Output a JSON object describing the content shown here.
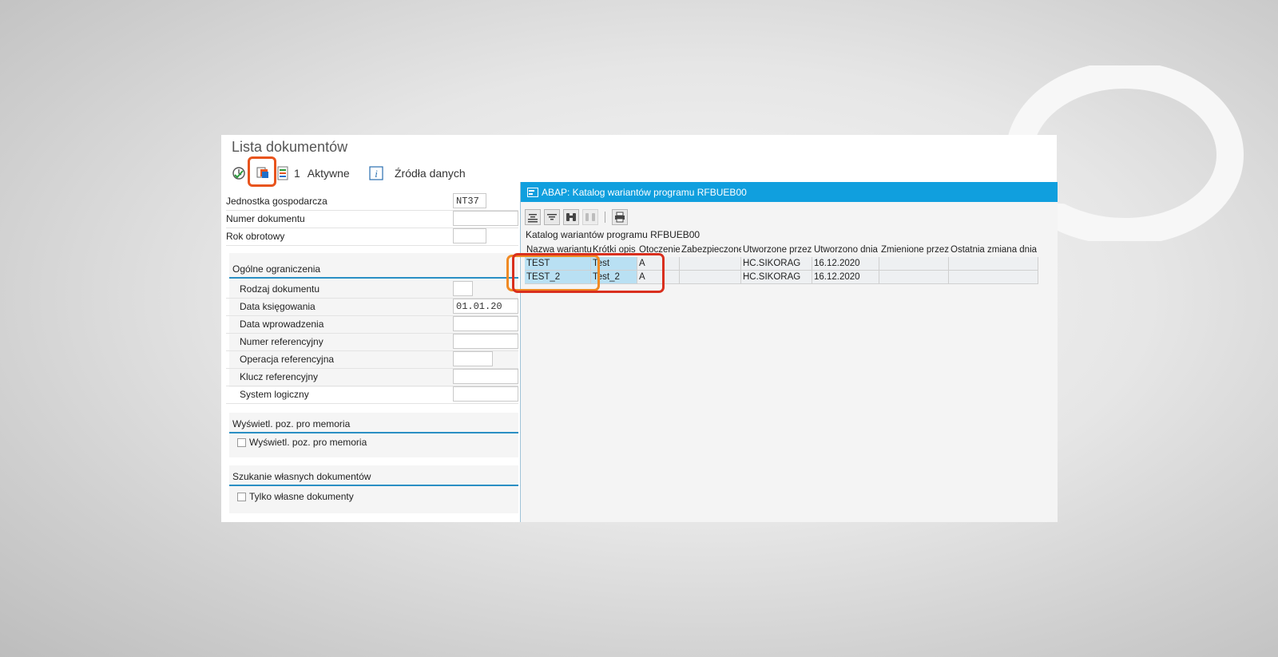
{
  "app": {
    "title": "Lista dokumentów"
  },
  "toolbar": {
    "count": "1",
    "active_label": "Aktywne",
    "sources_label": "Źródła danych"
  },
  "form": {
    "company_code": {
      "label": "Jednostka gospodarcza",
      "value": "NT37"
    },
    "doc_number": {
      "label": "Numer dokumentu",
      "value": ""
    },
    "fiscal_year": {
      "label": "Rok obrotowy",
      "value": ""
    },
    "general_group": {
      "title": "Ogólne ograniczenia",
      "doc_type": {
        "label": "Rodzaj dokumentu",
        "value": ""
      },
      "posting_date": {
        "label": "Data księgowania",
        "value": "01.01.20"
      },
      "entry_date": {
        "label": "Data wprowadzenia",
        "value": ""
      },
      "ref_number": {
        "label": "Numer referencyjny",
        "value": ""
      },
      "ref_operation": {
        "label": "Operacja referencyjna",
        "value": ""
      },
      "ref_key": {
        "label": "Klucz referencyjny",
        "value": ""
      },
      "logical_system": {
        "label": "System logiczny",
        "value": ""
      }
    },
    "memo_group": {
      "title": "Wyświetl. poz. pro memoria",
      "checkbox_label": "Wyświetl. poz. pro memoria"
    },
    "own_group": {
      "title": "Szukanie własnych dokumentów",
      "checkbox_label": "Tylko własne dokumenty"
    }
  },
  "popup": {
    "title": "ABAP: Katalog wariantów programu RFBUEB00",
    "subtitle": "Katalog wariantów programu RFBUEB00",
    "columns": [
      "Nazwa wariantu",
      "Krótki opis",
      "Otoczenie",
      "Zabezpieczone",
      "Utworzone przez",
      "Utworzono dnia",
      "Zmienione przez",
      "Ostatnia zmiana dnia"
    ],
    "rows": [
      [
        "TEST",
        "Test",
        "A",
        "",
        "HC.SIKORAG",
        "16.12.2020",
        "",
        ""
      ],
      [
        "TEST_2",
        "Test_2",
        "A",
        "",
        "HC.SIKORAG",
        "16.12.2020",
        "",
        ""
      ]
    ]
  },
  "colors": {
    "accent_blue": "#109fde",
    "highlight_orange": "#f08a24",
    "highlight_red": "#d92f1e"
  }
}
